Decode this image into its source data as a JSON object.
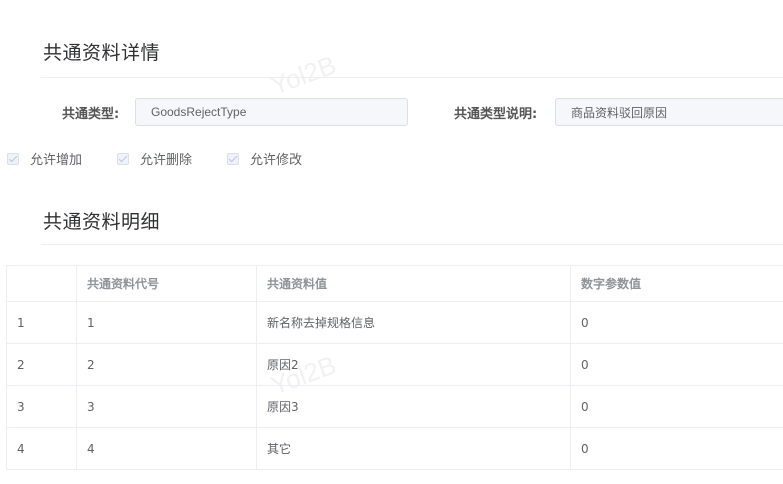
{
  "detail_section": {
    "title": "共通资料详情",
    "type_label": "共通类型:",
    "type_value": "GoodsRejectType",
    "desc_label": "共通类型说明:",
    "desc_value": "商品资料驳回原因"
  },
  "permissions": [
    {
      "label": "允许增加",
      "checked": true,
      "disabled": true
    },
    {
      "label": "允许删除",
      "checked": true,
      "disabled": true
    },
    {
      "label": "允许修改",
      "checked": true,
      "disabled": true
    }
  ],
  "items_section": {
    "title": "共通资料明细",
    "columns": [
      "",
      "共通资料代号",
      "共通资料值",
      "数字参数值"
    ],
    "rows": [
      [
        "1",
        "1",
        "新名称去掉规格信息",
        "0"
      ],
      [
        "2",
        "2",
        "原因2",
        "0"
      ],
      [
        "3",
        "3",
        "原因3",
        "0"
      ],
      [
        "4",
        "4",
        "其它",
        "0"
      ]
    ]
  },
  "watermark_text": "Yol2B"
}
